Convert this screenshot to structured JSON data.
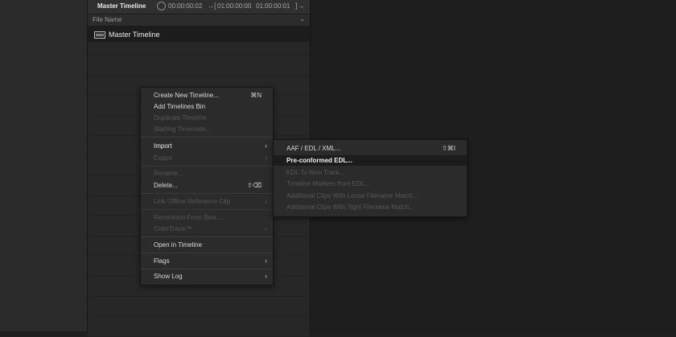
{
  "panel": {
    "title": "Master Timeline",
    "timecode_current": "00:00:00:02",
    "in_marker": "→[",
    "timecode_in": "01:00:00:00",
    "timecode_out": "01:00:00:01",
    "out_marker": "]→",
    "column_header": "File Name",
    "column_chevron": "⌄"
  },
  "list": {
    "items": [
      {
        "label": "Master Timeline"
      }
    ]
  },
  "context_menu": {
    "items": [
      {
        "label": "Create New Timeline...",
        "shortcut": "⌘N",
        "enabled": true
      },
      {
        "label": "Add Timelines Bin",
        "enabled": true
      },
      {
        "label": "Duplicate Timeline",
        "enabled": false
      },
      {
        "label": "Starting Timecode...",
        "enabled": false
      },
      {
        "label": "Import",
        "enabled": true,
        "arrow": "›"
      },
      {
        "label": "Export",
        "enabled": false,
        "arrow": "›"
      },
      {
        "label": "Rename...",
        "enabled": false
      },
      {
        "label": "Delete...",
        "shortcut": "⇧⌫",
        "enabled": true
      },
      {
        "label": "Link Offline Reference Clip",
        "enabled": false,
        "arrow": "›"
      },
      {
        "label": "Reconform From Bins...",
        "enabled": false
      },
      {
        "label": "ColorTrace™",
        "enabled": false,
        "arrow": "›"
      },
      {
        "label": "Open in Timeline",
        "enabled": true
      },
      {
        "label": "Flags",
        "enabled": true,
        "arrow": "›"
      },
      {
        "label": "Show Log",
        "enabled": true,
        "arrow": "›"
      }
    ]
  },
  "submenu": {
    "items": [
      {
        "label": "AAF / EDL / XML...",
        "shortcut": "⇧⌘I",
        "enabled": true
      },
      {
        "label": "Pre-conformed EDL...",
        "enabled": true,
        "highlighted": true
      },
      {
        "label": "EDL To New Track...",
        "enabled": false
      },
      {
        "label": "Timeline Markers from EDL...",
        "enabled": false
      },
      {
        "label": "Additional Clips With Loose Filename Match...",
        "enabled": false
      },
      {
        "label": "Additional Clips With Tight Filename Match...",
        "enabled": false
      }
    ]
  }
}
